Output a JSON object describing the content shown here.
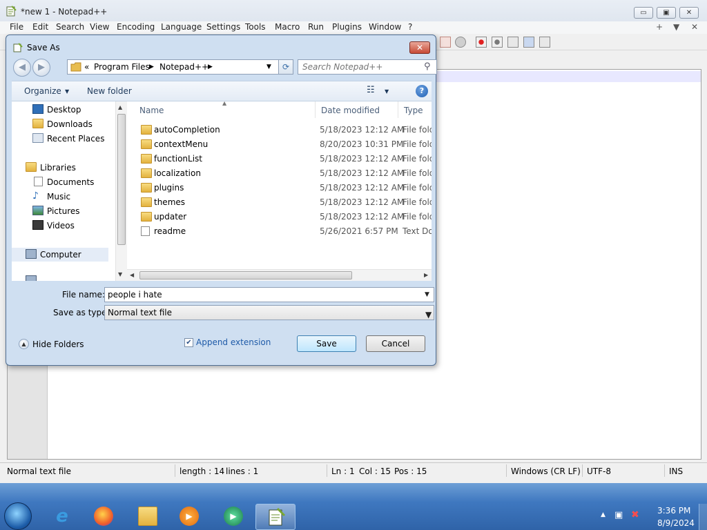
{
  "app": {
    "title": "*new 1 - Notepad++",
    "menu": [
      "File",
      "Edit",
      "Search",
      "View",
      "Encoding",
      "Language",
      "Settings",
      "Tools",
      "Macro",
      "Run",
      "Plugins",
      "Window",
      "?"
    ],
    "menu_right": [
      "+",
      "▼",
      "✕"
    ],
    "window_controls": {
      "minimize": "▭",
      "maximize": "▣",
      "close": "✕"
    }
  },
  "dialog": {
    "title": "Save As",
    "close": "✕",
    "breadcrumb": {
      "chevron": "«",
      "items": [
        "Program Files",
        "Notepad++"
      ]
    },
    "search_placeholder": "Search Notepad++",
    "organize": "Organize",
    "new_folder": "New folder",
    "nav": {
      "favorites": [
        {
          "label": "Desktop",
          "icon": "desktop-icon"
        },
        {
          "label": "Downloads",
          "icon": "downloads-folder-icon"
        },
        {
          "label": "Recent Places",
          "icon": "recent-places-icon"
        }
      ],
      "libraries": {
        "label": "Libraries",
        "icon": "libraries-icon"
      },
      "library_items": [
        {
          "label": "Documents",
          "icon": "documents-icon"
        },
        {
          "label": "Music",
          "icon": "music-icon"
        },
        {
          "label": "Pictures",
          "icon": "pictures-icon"
        },
        {
          "label": "Videos",
          "icon": "videos-icon"
        }
      ],
      "computer": {
        "label": "Computer",
        "icon": "computer-icon"
      }
    },
    "columns": [
      "Name",
      "Date modified",
      "Type"
    ],
    "files": [
      {
        "name": "autoCompletion",
        "date": "5/18/2023 12:12 AM",
        "type": "File folder",
        "icon": "folder-icon"
      },
      {
        "name": "contextMenu",
        "date": "8/20/2023 10:31 PM",
        "type": "File folder",
        "icon": "folder-icon"
      },
      {
        "name": "functionList",
        "date": "5/18/2023 12:12 AM",
        "type": "File folder",
        "icon": "folder-icon"
      },
      {
        "name": "localization",
        "date": "5/18/2023 12:12 AM",
        "type": "File folder",
        "icon": "folder-icon"
      },
      {
        "name": "plugins",
        "date": "5/18/2023 12:12 AM",
        "type": "File folder",
        "icon": "folder-icon"
      },
      {
        "name": "themes",
        "date": "5/18/2023 12:12 AM",
        "type": "File folder",
        "icon": "folder-icon"
      },
      {
        "name": "updater",
        "date": "5/18/2023 12:12 AM",
        "type": "File folder",
        "icon": "folder-icon"
      },
      {
        "name": "readme",
        "date": "5/26/2021 6:57 PM",
        "type": "Text Docu",
        "icon": "text-document-icon"
      }
    ],
    "file_name_label": "File name:",
    "file_name_value": "people i hate",
    "save_as_type_label": "Save as type:",
    "save_as_type_value": "Normal text file",
    "hide_folders": "Hide Folders",
    "append_extension": "Append extension",
    "append_extension_checked": true,
    "save": "Save",
    "cancel": "Cancel"
  },
  "status": {
    "type": "Normal text file",
    "length": "length : 14",
    "lines": "lines : 1",
    "ln": "Ln : 1",
    "col": "Col : 15",
    "pos": "Pos : 15",
    "eol": "Windows (CR LF)",
    "encoding": "UTF-8",
    "mode": "INS"
  },
  "taskbar": {
    "apps": [
      "Internet Explorer",
      "Firefox",
      "Windows Explorer",
      "Windows Media Player",
      "Media Center",
      "Notepad++"
    ],
    "time": "3:36 PM",
    "date": "8/9/2024"
  },
  "colors": {
    "dialog_frame": "#cfdff1",
    "taskbar": "#3f78c0",
    "link_blue": "#1e5aa8",
    "folder_yellow": "#e3b23f"
  }
}
